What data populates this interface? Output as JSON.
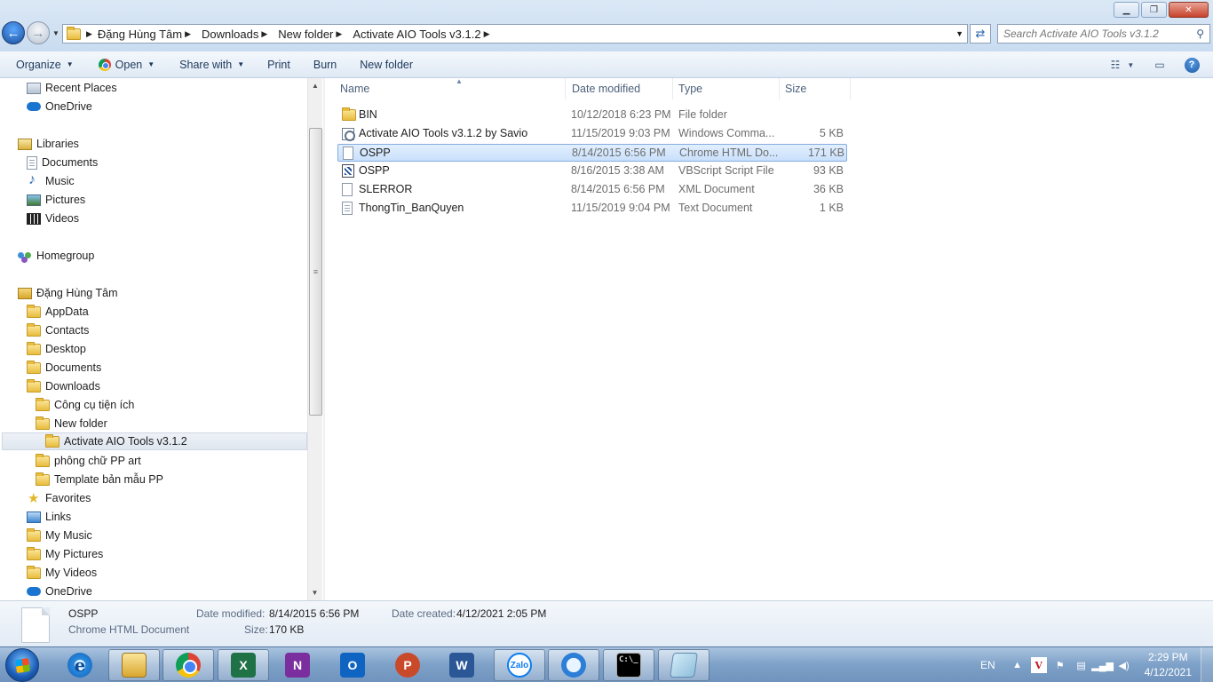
{
  "window": {
    "minimize_glyph": "▁",
    "maximize_glyph": "❐",
    "close_glyph": "✕"
  },
  "address": {
    "crumbs": [
      "Đặng Hùng Tâm",
      "Downloads",
      "New folder",
      "Activate AIO Tools v3.1.2"
    ]
  },
  "search": {
    "placeholder": "Search Activate AIO Tools v3.1.2"
  },
  "commands": {
    "organize": "Organize",
    "open": "Open",
    "share_with": "Share with",
    "print": "Print",
    "burn": "Burn",
    "new_folder": "New folder"
  },
  "nav": {
    "items": [
      {
        "label": "Recent Places",
        "icon": "recent-places-icon"
      },
      {
        "label": "OneDrive",
        "icon": "onedrive-icon"
      },
      {
        "label": "Libraries",
        "icon": "libraries-icon"
      },
      {
        "label": "Documents",
        "icon": "documents-icon"
      },
      {
        "label": "Music",
        "icon": "music-icon"
      },
      {
        "label": "Pictures",
        "icon": "pictures-icon"
      },
      {
        "label": "Videos",
        "icon": "videos-icon"
      },
      {
        "label": "Homegroup",
        "icon": "homegroup-icon"
      },
      {
        "label": "Đặng Hùng Tâm",
        "icon": "user-folder-icon"
      },
      {
        "label": "AppData",
        "icon": "folder-icon"
      },
      {
        "label": "Contacts",
        "icon": "folder-icon"
      },
      {
        "label": "Desktop",
        "icon": "folder-icon"
      },
      {
        "label": "Documents",
        "icon": "folder-icon"
      },
      {
        "label": "Downloads",
        "icon": "folder-icon"
      },
      {
        "label": "Công cụ tiện ích",
        "icon": "folder-icon"
      },
      {
        "label": "New folder",
        "icon": "folder-icon"
      },
      {
        "label": "Activate AIO Tools v3.1.2",
        "icon": "folder-icon",
        "selected": true
      },
      {
        "label": "phông chữ PP art",
        "icon": "folder-icon"
      },
      {
        "label": "Template bản mẫu PP",
        "icon": "folder-icon"
      },
      {
        "label": "Favorites",
        "icon": "favorites-icon"
      },
      {
        "label": "Links",
        "icon": "links-icon"
      },
      {
        "label": "My Music",
        "icon": "folder-icon"
      },
      {
        "label": "My Pictures",
        "icon": "folder-icon"
      },
      {
        "label": "My Videos",
        "icon": "folder-icon"
      },
      {
        "label": "OneDrive",
        "icon": "onedrive-icon"
      }
    ]
  },
  "columns": {
    "name": "Name",
    "date": "Date modified",
    "type": "Type",
    "size": "Size"
  },
  "files": [
    {
      "name": "BIN",
      "date": "10/12/2018 6:23 PM",
      "type": "File folder",
      "size": "",
      "icon": "folder-icon"
    },
    {
      "name": "Activate AIO Tools v3.1.2 by Savio",
      "date": "11/15/2019 9:03 PM",
      "type": "Windows Comma...",
      "size": "5 KB",
      "icon": "cmd-file-icon"
    },
    {
      "name": "OSPP",
      "date": "8/14/2015 6:56 PM",
      "type": "Chrome HTML Do...",
      "size": "171 KB",
      "icon": "html-file-icon",
      "selected": true
    },
    {
      "name": "OSPP",
      "date": "8/16/2015 3:38 AM",
      "type": "VBScript Script File",
      "size": "93 KB",
      "icon": "vbscript-file-icon"
    },
    {
      "name": "SLERROR",
      "date": "8/14/2015 6:56 PM",
      "type": "XML Document",
      "size": "36 KB",
      "icon": "xml-file-icon"
    },
    {
      "name": "ThongTin_BanQuyen",
      "date": "11/15/2019 9:04 PM",
      "type": "Text Document",
      "size": "1 KB",
      "icon": "text-file-icon"
    }
  ],
  "details": {
    "name": "OSPP",
    "type": "Chrome HTML Document",
    "modified_label": "Date modified:",
    "modified": "8/14/2015 6:56 PM",
    "size_label": "Size:",
    "size": "170 KB",
    "created_label": "Date created:",
    "created": "4/12/2021 2:05 PM"
  },
  "taskbar": {
    "apps": [
      "internet-explorer",
      "windows-explorer",
      "chrome",
      "excel",
      "onenote",
      "outlook",
      "powerpoint",
      "word",
      "zalo",
      "remote-desktop",
      "command-prompt",
      "notepad"
    ],
    "zalo_label": "Zalo",
    "lang": "EN",
    "time": "2:29 PM",
    "date": "4/12/2021"
  }
}
